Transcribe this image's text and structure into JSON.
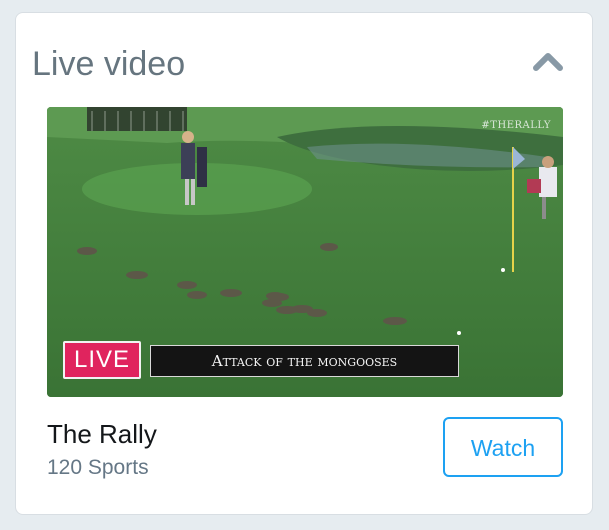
{
  "header": {
    "title": "Live video",
    "collapse_icon": "chevron-up-icon"
  },
  "video": {
    "hashtag": "#THERALLY",
    "live_label": "LIVE",
    "caption": "Attack of the mongooses"
  },
  "show": {
    "name": "The Rally",
    "subtitle": "120 Sports"
  },
  "actions": {
    "watch_label": "Watch"
  },
  "colors": {
    "accent": "#1da1f2",
    "live": "#e0245e",
    "title": "#66757f",
    "subtitle": "#657786"
  }
}
